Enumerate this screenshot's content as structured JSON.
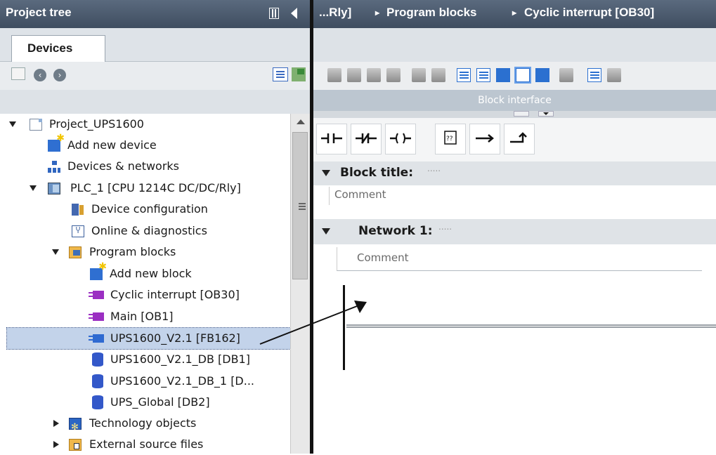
{
  "left_panel": {
    "title": "Project tree",
    "tab": "Devices"
  },
  "tree": [
    {
      "label": "Project_UPS1600",
      "icon": "project-icon"
    },
    {
      "label": "Add new device",
      "icon": "add-device-icon"
    },
    {
      "label": "Devices & networks",
      "icon": "network-icon"
    },
    {
      "label": "PLC_1 [CPU 1214C DC/DC/Rly]",
      "icon": "plc-icon"
    },
    {
      "label": "Device configuration",
      "icon": "device-config-icon"
    },
    {
      "label": "Online & diagnostics",
      "icon": "diagnostics-icon"
    },
    {
      "label": "Program blocks",
      "icon": "folder-icon"
    },
    {
      "label": "Add new block",
      "icon": "add-block-icon"
    },
    {
      "label": "Cyclic interrupt [OB30]",
      "icon": "ob-block-icon"
    },
    {
      "label": "Main [OB1]",
      "icon": "ob-block-icon"
    },
    {
      "label": "UPS1600_V2.1 [FB162]",
      "icon": "fb-block-icon"
    },
    {
      "label": "UPS1600_V2.1_DB [DB1]",
      "icon": "db-icon"
    },
    {
      "label": "UPS1600_V2.1_DB_1 [D...",
      "icon": "db-icon"
    },
    {
      "label": "UPS_Global [DB2]",
      "icon": "db-icon"
    },
    {
      "label": "Technology objects",
      "icon": "technology-icon"
    },
    {
      "label": "External source files",
      "icon": "external-source-icon"
    }
  ],
  "right_panel": {
    "breadcrumb": [
      "...Rly]",
      "Program blocks",
      "Cyclic interrupt [OB30]"
    ],
    "breadcrumb_sep": "▸",
    "block_interface": "Block interface",
    "block_title": "Block title:",
    "block_comment": "Comment",
    "network_title": "Network 1:",
    "network_comment": "Comment",
    "dots": "....."
  },
  "colors": {
    "title_bar": "#4a5a6e",
    "selection": "#c3d3ea",
    "accent_blue": "#2b70d0"
  }
}
